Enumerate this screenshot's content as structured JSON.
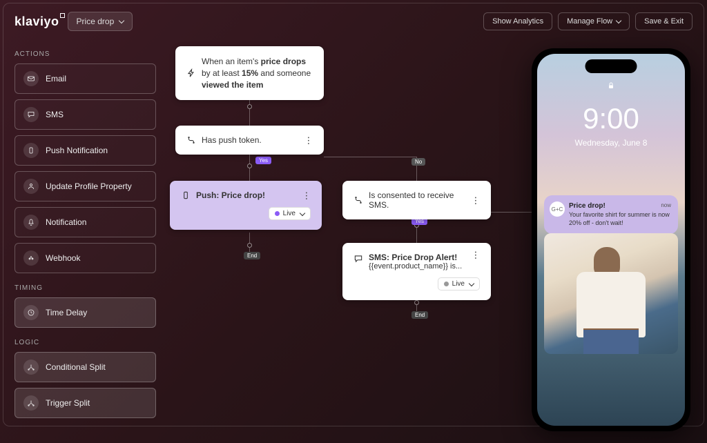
{
  "brand": "klaviyo",
  "flow_name": "Price drop",
  "header_buttons": {
    "analytics": "Show Analytics",
    "manage": "Manage Flow",
    "save": "Save & Exit"
  },
  "sidebar": {
    "sections": {
      "actions_label": "ACTIONS",
      "timing_label": "TIMING",
      "logic_label": "LOGIC"
    },
    "actions": [
      {
        "label": "Email"
      },
      {
        "label": "SMS"
      },
      {
        "label": "Push Notification"
      },
      {
        "label": "Update Profile Property"
      },
      {
        "label": "Notification"
      },
      {
        "label": "Webhook"
      }
    ],
    "timing": [
      {
        "label": "Time Delay"
      }
    ],
    "logic": [
      {
        "label": "Conditional Split"
      },
      {
        "label": "Trigger Split"
      }
    ]
  },
  "flow": {
    "trigger_pre": "When an item's ",
    "trigger_bold1": "price drops",
    "trigger_mid1": " by at least ",
    "trigger_bold2": "15%",
    "trigger_mid2": " and someone ",
    "trigger_bold3": "viewed the item",
    "check_label": "Has push token.",
    "push_label": "Push: Price drop!",
    "sms_check_label": "Is consented to receive SMS.",
    "sms_send_title": "SMS: Price Drop Alert!",
    "sms_send_body": "{{event.product_name}} is...",
    "status_live": "Live",
    "badges": {
      "yes": "Yes",
      "no": "No",
      "end": "End"
    }
  },
  "phone": {
    "time": "9:00",
    "date": "Wednesday, June 8",
    "notification": {
      "avatar": "G+C",
      "title": "Price drop!",
      "time": "now",
      "body": "Your favorite shirt for summer is now 20% off - don't wait!"
    }
  }
}
